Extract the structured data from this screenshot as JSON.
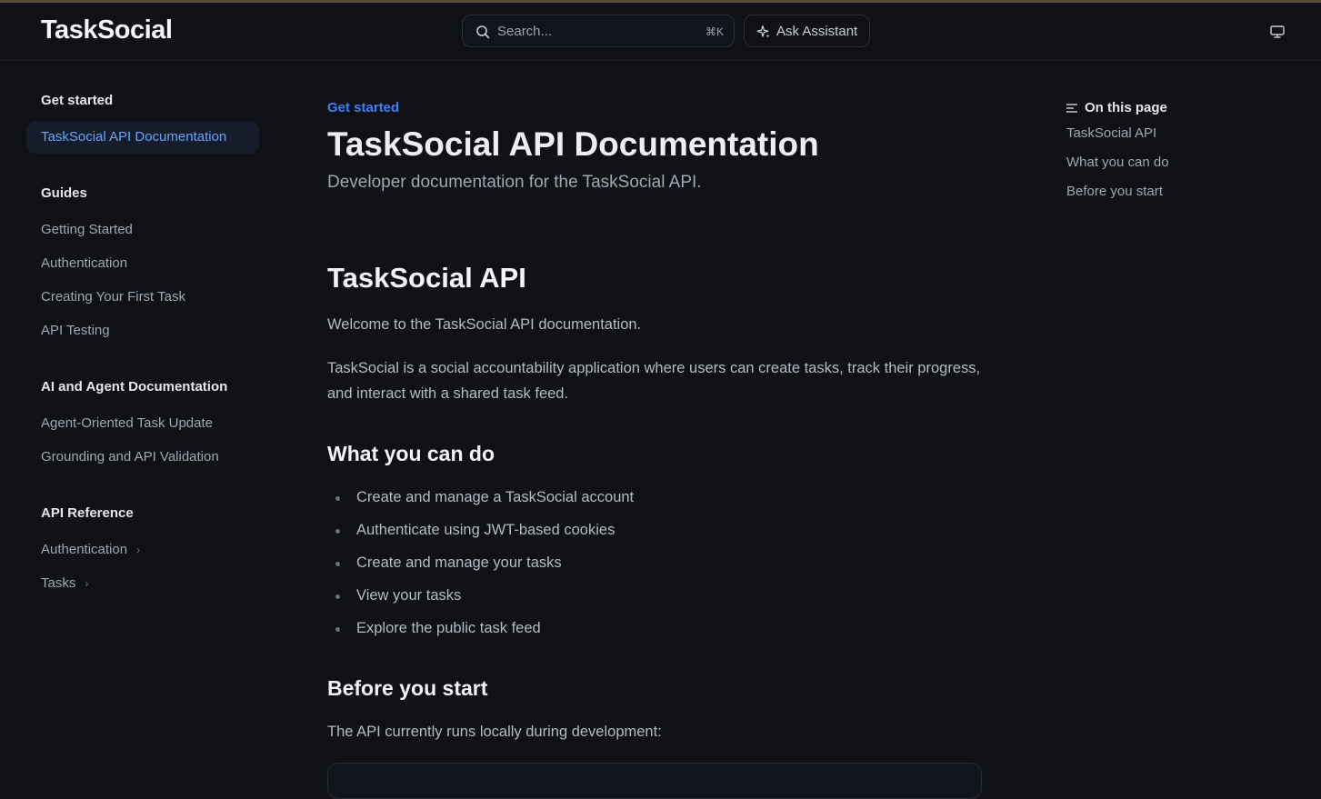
{
  "header": {
    "logo": "TaskSocial",
    "search_placeholder": "Search...",
    "search_shortcut": "⌘K",
    "assistant_label": "Ask Assistant"
  },
  "sidebar": {
    "get_started": {
      "title": "Get started",
      "items": [
        "TaskSocial API Documentation"
      ]
    },
    "guides": {
      "title": "Guides",
      "items": [
        "Getting Started",
        "Authentication",
        "Creating Your First Task",
        "API Testing"
      ]
    },
    "ai_docs": {
      "title": "AI and Agent Documentation",
      "items": [
        "Agent-Oriented Task Update",
        "Grounding and API Validation"
      ]
    },
    "api_reference": {
      "title": "API Reference",
      "items": [
        "Authentication",
        "Tasks"
      ]
    }
  },
  "content": {
    "breadcrumb": "Get started",
    "title": "TaskSocial API Documentation",
    "subtitle": "Developer documentation for the TaskSocial API.",
    "h2": "TaskSocial API",
    "p1": "Welcome to the TaskSocial API documentation.",
    "p2": "TaskSocial is a social accountability application where users can create tasks, track their progress, and interact with a shared task feed.",
    "h3_what": "What you can do",
    "list": [
      "Create and manage a TaskSocial account",
      "Authenticate using JWT-based cookies",
      "Create and manage your tasks",
      "View your tasks",
      "Explore the public task feed"
    ],
    "h3_before": "Before you start",
    "p3": "The API currently runs locally during development:"
  },
  "toc": {
    "title": "On this page",
    "items": [
      "TaskSocial API",
      "What you can do",
      "Before you start"
    ]
  },
  "colors": {
    "accent": "#3b82f6",
    "background": "#0f1117",
    "active_bg": "#161c2b"
  },
  "icons": {
    "search": "search-icon",
    "assistant": "sparkle-icon",
    "theme": "monitor-icon",
    "toc": "list-icon"
  }
}
